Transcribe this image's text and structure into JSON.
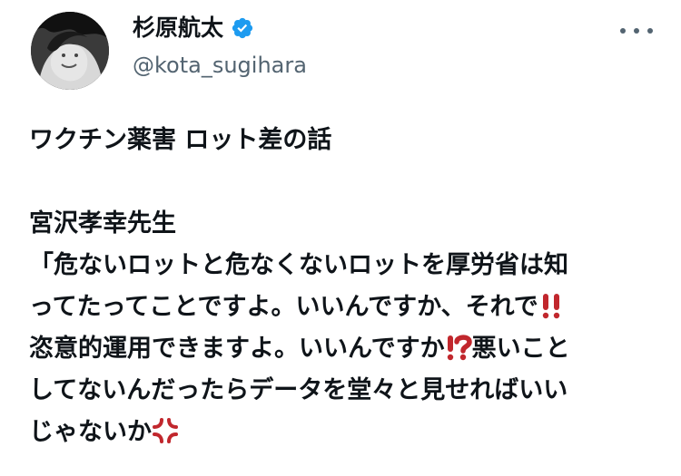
{
  "author": {
    "name": "杉原航太",
    "handle": "@kota_sugihara",
    "verified_color": "#1d9bf0"
  },
  "menu": {
    "icon": "more-horizontal-icon"
  },
  "tweet": {
    "lines": [
      "ワクチン薬害 ロット差の話",
      "",
      "宮沢孝幸先生",
      "「危ないロットと危なくないロットを厚労省は知",
      "ってたってことですよ。いいんですか、それで",
      "恣意的運用できますよ。いいんですか",
      "悪いこと",
      "してないんだったらデータを堂々と見せればいい",
      "じゃないか"
    ],
    "emojis": {
      "double_exclamation": "double-exclamation-emoji",
      "interrobang": "interrobang-emoji",
      "anger": "anger-symbol-emoji"
    }
  },
  "colors": {
    "text": "#0f1419",
    "secondary": "#536471",
    "emoji_red": "#c1272d"
  }
}
